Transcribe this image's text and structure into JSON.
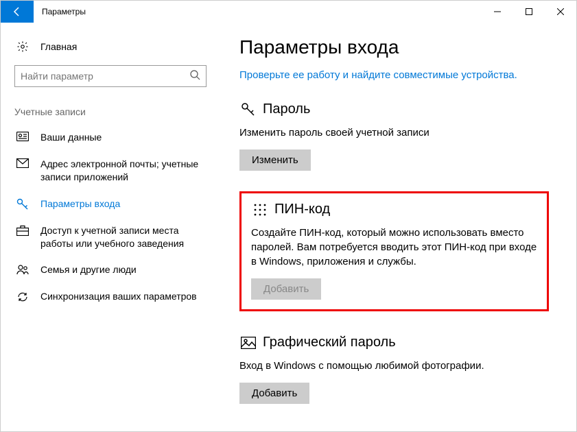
{
  "window": {
    "title": "Параметры"
  },
  "sidebar": {
    "home": "Главная",
    "search_placeholder": "Найти параметр",
    "category": "Учетные записи",
    "items": [
      {
        "label": "Ваши данные"
      },
      {
        "label": "Адрес электронной почты; учетные записи приложений"
      },
      {
        "label": "Параметры входа"
      },
      {
        "label": "Доступ к учетной записи места работы или учебного заведения"
      },
      {
        "label": "Семья и другие люди"
      },
      {
        "label": "Синхронизация ваших параметров"
      }
    ]
  },
  "content": {
    "title": "Параметры входа",
    "check_link": "Проверьте ее работу и найдите совместимые устройства.",
    "password": {
      "title": "Пароль",
      "desc": "Изменить пароль своей учетной записи",
      "btn": "Изменить"
    },
    "pin": {
      "title": "ПИН-код",
      "desc": "Создайте ПИН-код, который можно использовать вместо паролей. Вам потребуется вводить этот ПИН-код при входе в Windows, приложения и службы.",
      "btn": "Добавить"
    },
    "picture": {
      "title": "Графический пароль",
      "desc": "Вход в Windows с помощью любимой фотографии.",
      "btn": "Добавить"
    }
  }
}
